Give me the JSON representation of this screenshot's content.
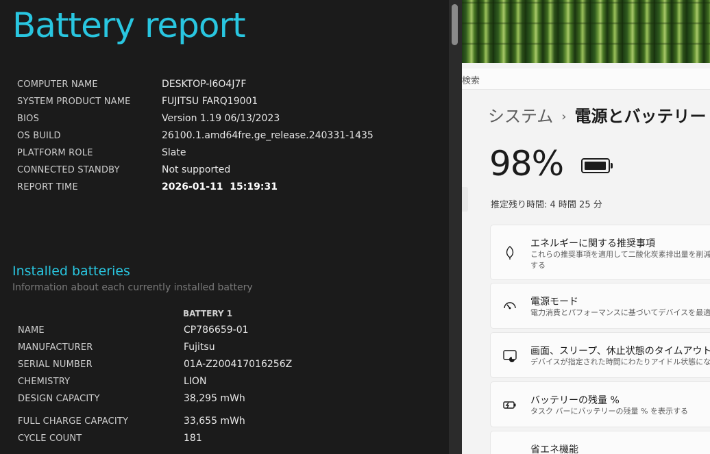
{
  "report": {
    "title": "Battery report",
    "system": [
      {
        "label": "COMPUTER NAME",
        "value": "DESKTOP-I6O4J7F"
      },
      {
        "label": "SYSTEM PRODUCT NAME",
        "value": "FUJITSU FARQ19001"
      },
      {
        "label": "BIOS",
        "value": "Version 1.19 06/13/2023"
      },
      {
        "label": "OS BUILD",
        "value": "26100.1.amd64fre.ge_release.240331-1435"
      },
      {
        "label": "PLATFORM ROLE",
        "value": "Slate"
      },
      {
        "label": "CONNECTED STANDBY",
        "value": "Not supported"
      },
      {
        "label": "REPORT TIME",
        "value": "2026-01-11  15:19:31"
      }
    ],
    "installed_title": "Installed batteries",
    "installed_subtitle": "Information about each currently installed battery",
    "battery_column": "BATTERY 1",
    "battery": [
      {
        "label": "NAME",
        "value": "CP786659-01"
      },
      {
        "label": "MANUFACTURER",
        "value": "Fujitsu"
      },
      {
        "label": "SERIAL NUMBER",
        "value": "01A-Z200417016256Z"
      },
      {
        "label": "CHEMISTRY",
        "value": "LION"
      },
      {
        "label": "DESIGN CAPACITY",
        "value": "38,295 mWh"
      },
      {
        "label": "FULL CHARGE CAPACITY",
        "value": "33,655 mWh"
      },
      {
        "label": "CYCLE COUNT",
        "value": "181"
      }
    ]
  },
  "settings": {
    "search_text": "検索",
    "breadcrumb_parent": "システム",
    "breadcrumb_sep": "›",
    "breadcrumb_current": "電源とバッテリー",
    "battery_percent": "98%",
    "battery_level": 0.98,
    "remaining": "推定残り時間: 4 時間 25 分",
    "cards": [
      {
        "title": "エネルギーに関する推奨事項",
        "desc": "これらの推奨事項を適用して二酸化炭素排出量を削減する",
        "icon": "leaf-icon"
      },
      {
        "title": "電源モード",
        "desc": "電力消費とパフォーマンスに基づいてデバイスを最適化",
        "icon": "power-mode-gauge-icon"
      },
      {
        "title": "画面、スリープ、休止状態のタイムアウト",
        "desc": "デバイスが指定された時間にわたりアイドル状態になった後",
        "icon": "screen-sleep-icon"
      },
      {
        "title": "バッテリーの残量 %",
        "desc": "タスク バーにバッテリーの残量 % を表示する",
        "icon": "battery-charging-icon"
      },
      {
        "title": "省エネ機能",
        "desc": "",
        "icon": "energy-saver-icon"
      }
    ]
  },
  "colors": {
    "report_accent": "#29c6e0",
    "report_bg": "#1b1b1b",
    "settings_bg": "#f3f3f3"
  }
}
